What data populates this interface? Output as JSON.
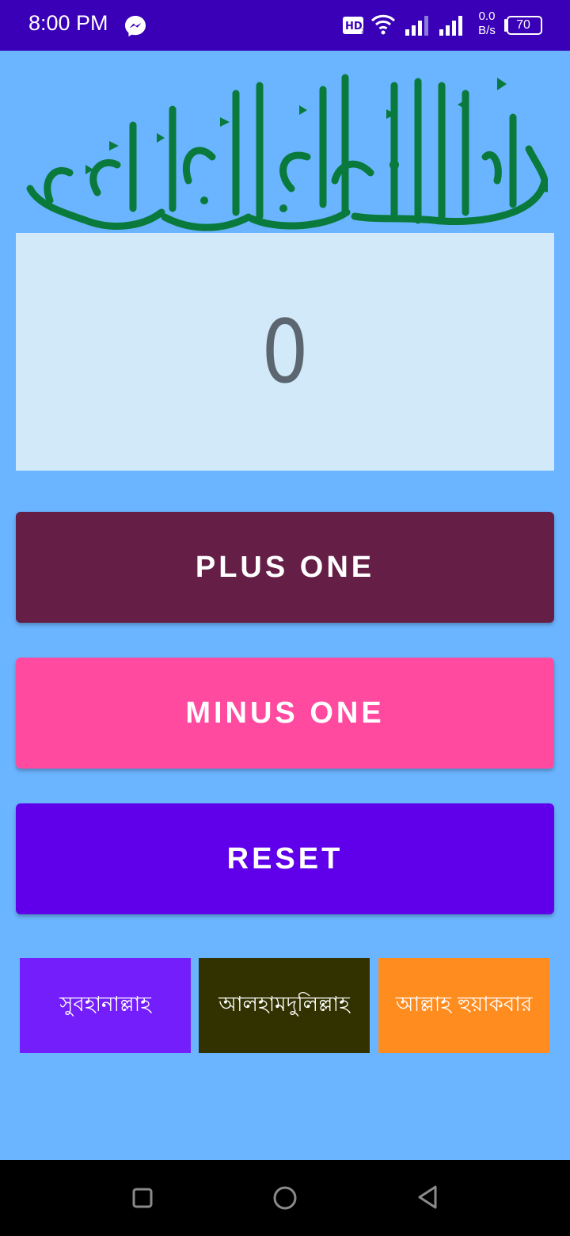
{
  "status_bar": {
    "time": "8:00 PM",
    "network_speed_value": "0.0",
    "network_speed_unit": "B/s",
    "battery_level": "70",
    "icons": [
      "messenger-icon",
      "hd-icon",
      "wifi-icon",
      "signal-icon",
      "signal-icon",
      "battery-icon"
    ]
  },
  "header": {
    "logo": "bismillah-calligraphy",
    "logo_text": "بسم الله الرحمن الرحيم",
    "logo_color": "#0a7a3c"
  },
  "counter": {
    "value": "0"
  },
  "buttons": {
    "plus_label": "PLUS ONE",
    "minus_label": "MINUS ONE",
    "reset_label": "RESET"
  },
  "dhikr": [
    {
      "label": "সুবহানাল্লাহ",
      "color": "#741ffb"
    },
    {
      "label": "আলহামদুলিল্লাহ",
      "color": "#323200"
    },
    {
      "label": "আল্লাহ হুয়াকবার",
      "color": "#ff8c1f"
    }
  ],
  "nav_bar": {
    "icons": [
      "recents-icon",
      "home-icon",
      "back-icon"
    ]
  },
  "colors": {
    "status_bar": "#3a00b8",
    "background": "#6bb4ff",
    "counter_panel": "#d1e9f9",
    "plus_button": "#651e46",
    "minus_button": "#ff4aa0",
    "reset_button": "#6000eb"
  }
}
